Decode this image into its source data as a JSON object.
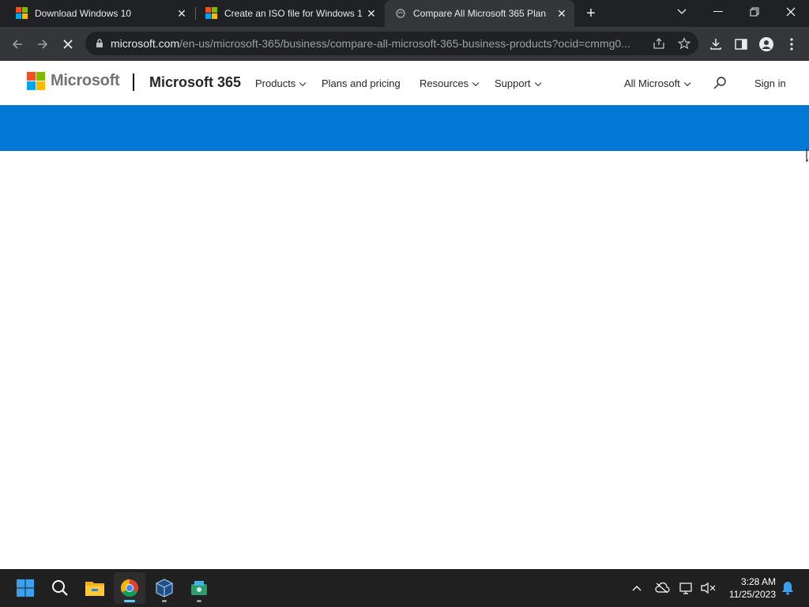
{
  "browser": {
    "tabs": [
      {
        "title": "Download Windows 10",
        "favicon": "microsoft-logo",
        "active": false
      },
      {
        "title": "Create an ISO file for Windows 1",
        "favicon": "microsoft-logo",
        "active": false
      },
      {
        "title": "Compare All Microsoft 365 Plan",
        "favicon": "loading-globe",
        "active": true
      }
    ],
    "url_host": "microsoft.com",
    "url_path": "/en-us/microsoft-365/business/compare-all-microsoft-365-business-products?ocid=cmmg0...",
    "loading": true
  },
  "site": {
    "brand": "Microsoft",
    "product": "Microsoft 365",
    "nav": {
      "products": "Products",
      "plans": "Plans and pricing",
      "resources": "Resources",
      "support": "Support",
      "all_microsoft": "All Microsoft",
      "sign_in": "Sign in"
    },
    "banner_color": "#0078d4"
  },
  "taskbar": {
    "apps": [
      "start-icon",
      "search-icon",
      "file-explorer-icon",
      "chrome-icon",
      "virtualbox-icon",
      "app-icon"
    ],
    "time": "3:28 AM",
    "date": "11/25/2023"
  }
}
